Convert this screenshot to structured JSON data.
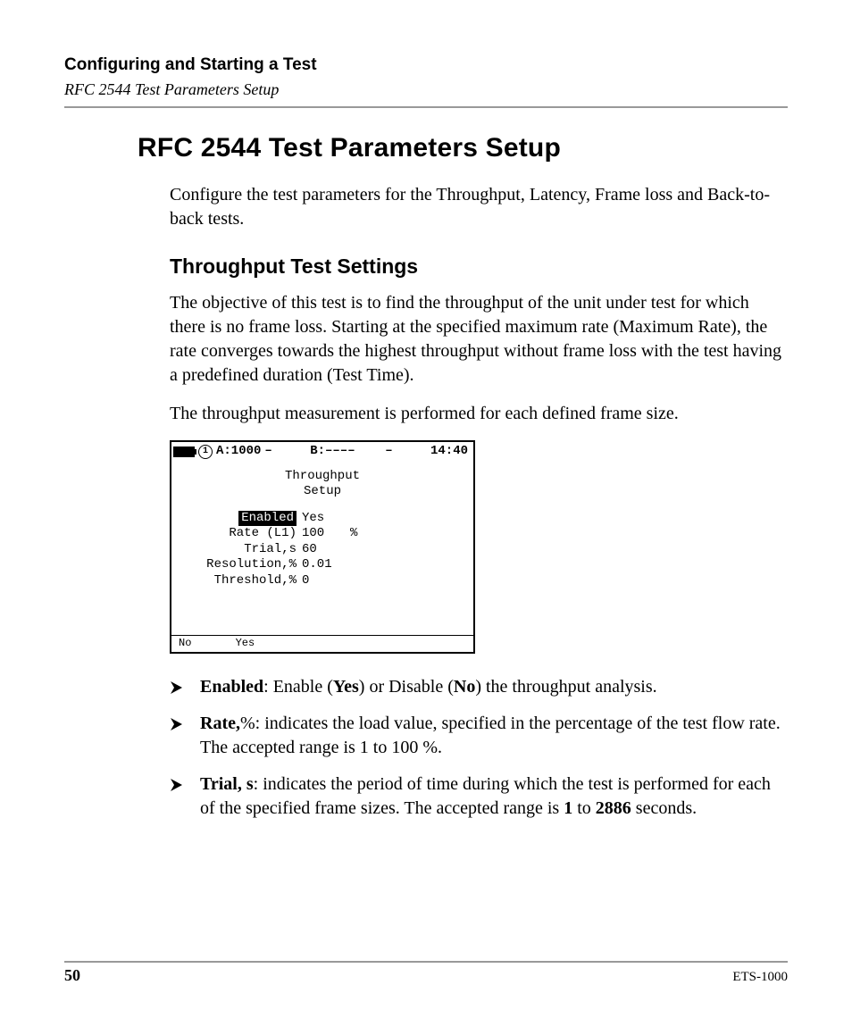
{
  "header": {
    "chapter": "Configuring and Starting a Test",
    "breadcrumb": "RFC 2544 Test Parameters Setup"
  },
  "section": {
    "title": "RFC 2544 Test Parameters Setup",
    "intro": "Configure the test parameters for the Throughput, Latency, Frame loss and Back-to-back tests."
  },
  "subsection": {
    "title": "Throughput Test Settings",
    "p1": "The objective of this test is to find the throughput of the unit under test for which there is no frame loss. Starting at the specified maximum rate (Maximum Rate), the rate converges towards the highest throughput without frame loss with the test having a predefined duration (Test Time).",
    "p2": "The throughput measurement is performed for each defined frame size."
  },
  "device": {
    "status": {
      "indicator": "1",
      "portA": "A:1000",
      "dashA": "–",
      "portB": "B:––––",
      "dashB": "–",
      "time": "14:40"
    },
    "title_l1": "Throughput",
    "title_l2": "Setup",
    "params": [
      {
        "label": "Enabled",
        "value": "Yes",
        "unit": "",
        "selected": true
      },
      {
        "label": "Rate (L1)",
        "value": "100",
        "unit": "%",
        "selected": false
      },
      {
        "label": "Trial,s",
        "value": "60",
        "unit": "",
        "selected": false
      },
      {
        "label": "Resolution,%",
        "value": "0.01",
        "unit": "",
        "selected": false
      },
      {
        "label": "Threshold,%",
        "value": "0",
        "unit": "",
        "selected": false
      }
    ],
    "footer": {
      "opt1": "No",
      "opt2": "Yes"
    }
  },
  "bullets": {
    "b1": {
      "term": "Enabled",
      "sep": ": Enable (",
      "yes": "Yes",
      "mid": ") or Disable (",
      "no": "No",
      "tail": ") the throughput analysis."
    },
    "b2": {
      "term": "Rate,",
      "tail": "%: indicates the load value, specified in the percentage of the test flow rate. The accepted range is 1 to 100 %."
    },
    "b3": {
      "term": "Trial, s",
      "lead": ": indicates the period of time during which the test is performed for each of the specified frame sizes. The accepted range is ",
      "n1": "1",
      "mid": " to ",
      "n2": "2886",
      "tail": " seconds."
    }
  },
  "footer": {
    "page": "50",
    "model": "ETS-1000"
  }
}
